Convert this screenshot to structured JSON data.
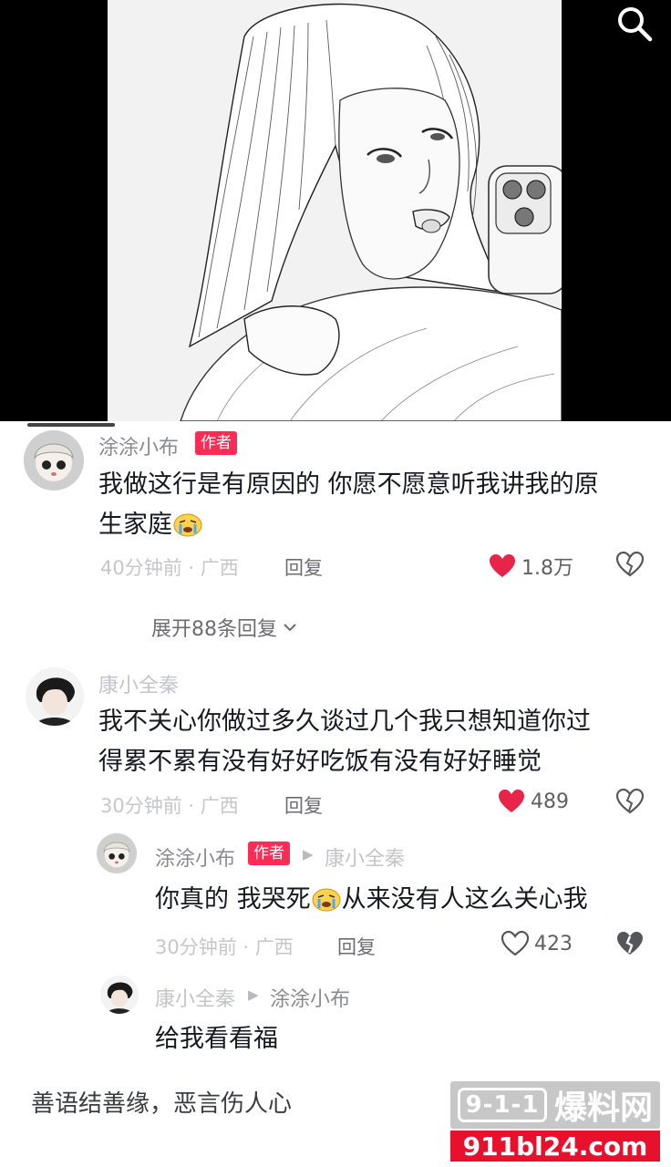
{
  "icons": {
    "search": "search-icon",
    "like": "heart-icon",
    "dislike": "broken-heart-icon",
    "cry_emoji": "crying-face-emoji",
    "expand": "chevron-down-icon",
    "reply_arrow": "play-arrow-icon"
  },
  "colors": {
    "like_active": "#fe2c55",
    "author_tag": "#fe2c55",
    "watermark_red": "#e8112d"
  },
  "comments": [
    {
      "username": "涂涂小布",
      "author_tag": "作者",
      "text": "我做这行是有原因的 你愿不愿意听我讲我的原",
      "text_line2": "生家庭",
      "time": "40分钟前",
      "location": "广西",
      "dot": "·",
      "reply_label": "回复",
      "likes": "1.8万",
      "liked": true,
      "expand_label": "展开88条回复"
    },
    {
      "username": "康小全秦",
      "text": "我不关心你做过多久谈过几个我只想知道你过",
      "text_line2": "得累不累有没有好好吃饭有没有好好睡觉",
      "time": "30分钟前",
      "location": "广西",
      "dot": "·",
      "reply_label": "回复",
      "likes": "489",
      "liked": true
    }
  ],
  "replies": [
    {
      "username": "涂涂小布",
      "author_tag": "作者",
      "reply_to": "康小全秦",
      "text_a": "你真的 我哭死",
      "text_b": "从来没有人这么关心我",
      "time": "30分钟前",
      "location": "广西",
      "dot": "·",
      "reply_label": "回复",
      "likes": "423",
      "liked": false
    },
    {
      "username": "康小全秦",
      "reply_to": "涂涂小布",
      "text": "给我看看福"
    }
  ],
  "footer_text": "善语结善缘，恶言伤人心",
  "watermark": {
    "badge": "9-1-1",
    "name": "爆料网",
    "url": "911bl24.com"
  }
}
